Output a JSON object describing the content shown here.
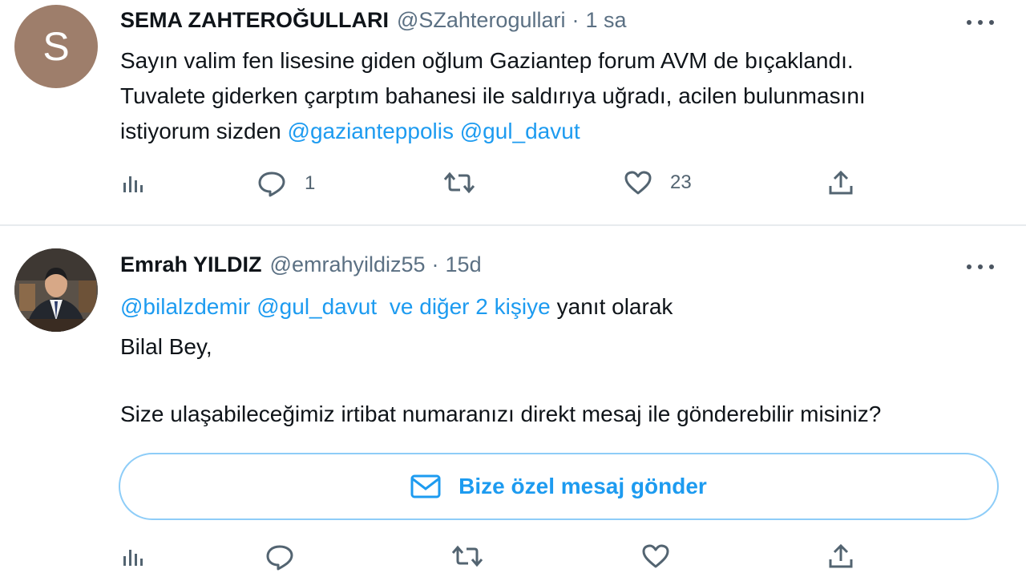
{
  "tweets": [
    {
      "avatar_letter": "S",
      "name": "SEMA ZAHTEROĞULLARI",
      "handle": "@SZahterogullari",
      "separator": "·",
      "time": "1 sa",
      "text_lines": [
        "Sayın valim fen lisesine giden oğlum Gaziantep forum AVM de bıçaklandı.",
        "Tuvalete giderken çarptım bahanesi ile saldırıya uğradı, acilen bulunmasını",
        "istiyorum sizden"
      ],
      "mentions": [
        "@gazianteppolis",
        "@gul_davut"
      ],
      "actions": {
        "analytics_icon": "bar-chart-icon",
        "reply_count": "1",
        "retweet_count": "",
        "like_count": "23"
      }
    },
    {
      "avatar": "profile-photo",
      "name": "Emrah YILDIZ",
      "handle": "@emrahyildiz55",
      "separator": "·",
      "time": "15d",
      "reply_to": {
        "mentions": [
          "@bilalzdemir",
          "@gul_davut"
        ],
        "others": "ve diğer 2 kişiye",
        "suffix": "yanıt olarak"
      },
      "greeting": "Bilal Bey,",
      "question": "Size ulaşabileceğimiz irtibat numaranızı direkt mesaj ile gönderebilir misiniz?",
      "dm_button": {
        "label": "Bize özel mesaj gönder",
        "icon": "envelope-icon"
      },
      "actions": {
        "reply_count": "",
        "retweet_count": "",
        "like_count": ""
      }
    }
  ],
  "colors": {
    "link": "#1d9bf0",
    "secondary_text": "#5b7083",
    "button_border": "#8ecdf8"
  }
}
